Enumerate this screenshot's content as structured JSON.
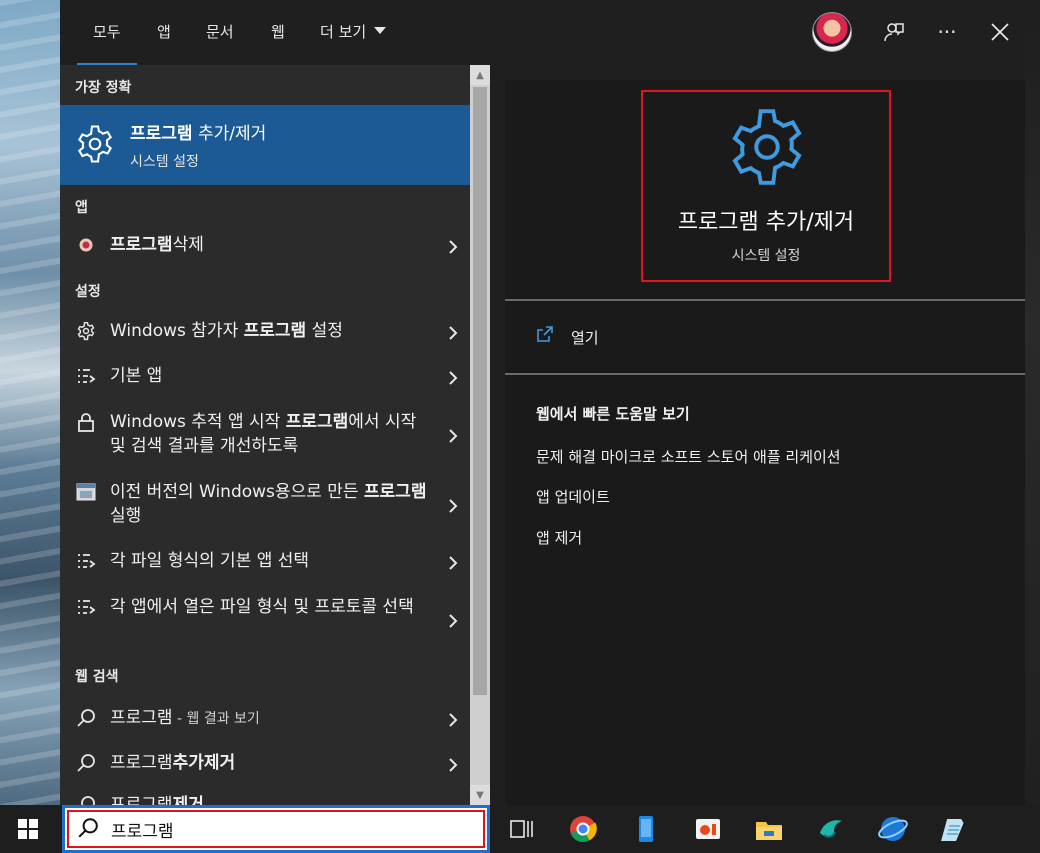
{
  "tabs": [
    {
      "label": "모두",
      "active": true
    },
    {
      "label": "앱"
    },
    {
      "label": "문서"
    },
    {
      "label": "웹"
    },
    {
      "label": "더 보기"
    }
  ],
  "sections": {
    "best": "가장 정확",
    "apps": "앱",
    "settings": "설정",
    "web": "웹 검색"
  },
  "best_match": {
    "title_bold": "프로그램",
    "title_rest": " 추가/제거",
    "subtitle": "시스템 설정",
    "icon": "gear-icon"
  },
  "app_results": [
    {
      "bold": "프로그램",
      "rest": "삭제",
      "icon": "app-avatar-icon"
    }
  ],
  "settings_results": [
    {
      "pre": "Windows 참가자 ",
      "bold": "프로그램",
      "post": " 설정",
      "icon": "gear-icon"
    },
    {
      "pre": "기본 앱",
      "bold": "",
      "post": "",
      "icon": "list-icon"
    },
    {
      "pre": "Windows 추적 앱 시작 ",
      "bold": "프로그램",
      "post": "에서 시작 및 검색 결과를 개선하도록",
      "icon": "lock-icon"
    },
    {
      "pre": "이전 버전의 Windows용으로 만든 ",
      "bold": "프로그램",
      "post": " 실행",
      "icon": "compat-icon"
    },
    {
      "pre": "각 파일 형식의 기본 앱 선택",
      "bold": "",
      "post": "",
      "icon": "list-icon"
    },
    {
      "pre": "각 앱에서 열은 파일 형식 및 프로토콜 선택",
      "bold": "",
      "post": "",
      "icon": "list-icon"
    }
  ],
  "web_results": [
    {
      "pre": "프로그램",
      "small": " - 웹 결과 보기",
      "bold": ""
    },
    {
      "pre": "프로그램",
      "small": "",
      "bold": "추가제거"
    },
    {
      "pre": "프로그램",
      "small": "",
      "bold": "제거"
    }
  ],
  "detail": {
    "title": "프로그램 추가/제거",
    "subtitle": "시스템 설정",
    "open_label": "열기",
    "help_title": "웹에서 빠른 도움말 보기",
    "help_links": [
      "문제 해결 마이크로 소프트 스토어 애플 리케이션",
      "앱 업데이트",
      "앱 제거"
    ]
  },
  "search": {
    "value": "프로그램"
  },
  "colors": {
    "accent": "#1c5a96",
    "highlight_border": "#e0141e",
    "gear": "#3e9be0"
  }
}
